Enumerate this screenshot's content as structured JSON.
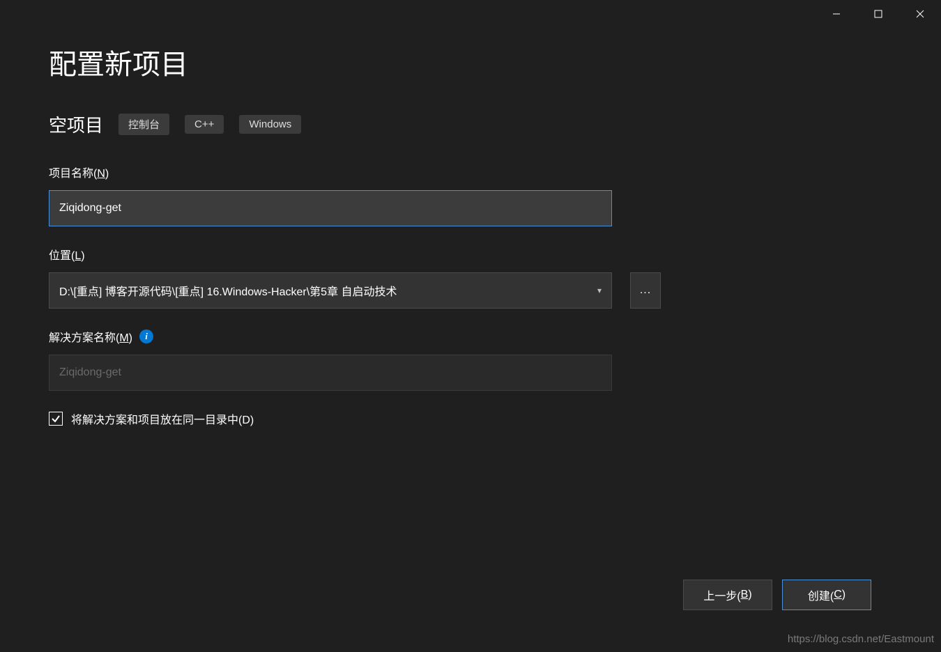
{
  "titlebar": {
    "minimize": "—",
    "maximize": "□",
    "close": "✕"
  },
  "page": {
    "title": "配置新项目",
    "subtitle": "空项目",
    "tags": [
      "控制台",
      "C++",
      "Windows"
    ]
  },
  "fields": {
    "projectName": {
      "label_prefix": "项目名称(",
      "label_hotkey": "N",
      "label_suffix": ")",
      "value": "Ziqidong-get"
    },
    "location": {
      "label_prefix": "位置(",
      "label_hotkey": "L",
      "label_suffix": ")",
      "value": "D:\\[重点] 博客开源代码\\[重点] 16.Windows-Hacker\\第5章 自启动技术",
      "browse": "..."
    },
    "solutionName": {
      "label_prefix": "解决方案名称(",
      "label_hotkey": "M",
      "label_suffix": ")",
      "placeholder": "Ziqidong-get"
    },
    "sameDirectory": {
      "label_prefix": "将解决方案和项目放在同一目录中(",
      "label_hotkey": "D",
      "label_suffix": ")",
      "checked": true
    }
  },
  "buttons": {
    "back_prefix": "上一步(",
    "back_hotkey": "B",
    "back_suffix": ")",
    "create_prefix": "创建(",
    "create_hotkey": "C",
    "create_suffix": ")"
  },
  "watermark": "https://blog.csdn.net/Eastmount"
}
